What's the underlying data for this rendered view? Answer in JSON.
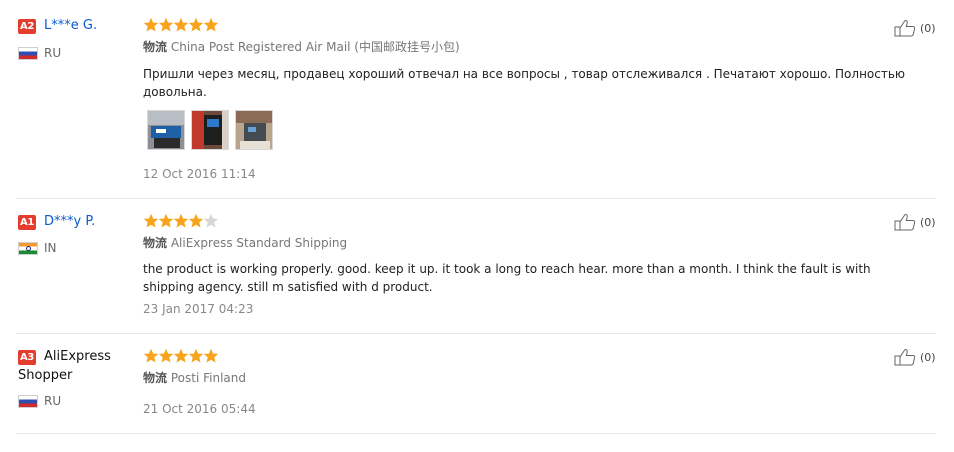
{
  "reviews": [
    {
      "badge": "A2",
      "name": "L***e G.",
      "country": "RU",
      "rating": 5,
      "shipping_label": "物流",
      "shipping_method": "China Post Registered Air Mail (中国邮政挂号小包)",
      "text": "Пришли через месяц, продавец хороший отвечал на все вопросы , товар отслеживался . Печатают хорошо. Полностью довольна.",
      "date": "12 Oct 2016 11:14",
      "helpful": "(0)",
      "photo_count": 3
    },
    {
      "badge": "A1",
      "name": "D***y P.",
      "country": "IN",
      "rating": 4,
      "shipping_label": "物流",
      "shipping_method": "AliExpress Standard Shipping",
      "text": "the product is working properly. good. keep it up. it took a long to reach hear. more than a month. I think the fault is with shipping agency. still m satisfied with d product.",
      "date": "23 Jan 2017 04:23",
      "helpful": "(0)"
    },
    {
      "badge": "A3",
      "name_line1": "AliExpress",
      "name_line2": "Shopper",
      "country": "RU",
      "rating": 5,
      "shipping_label": "物流",
      "shipping_method": "Posti Finland",
      "date": "21 Oct 2016 05:44",
      "helpful": "(0)"
    }
  ],
  "colors": {
    "badge": "#e43d2e",
    "star_filled": "#f7a31c",
    "star_empty": "#d6d6d6",
    "name_link": "#0a5bd1"
  },
  "icons": {
    "helpful": "thumbs-up-icon",
    "star": "star-icon",
    "flag": "country-flag-icon"
  }
}
